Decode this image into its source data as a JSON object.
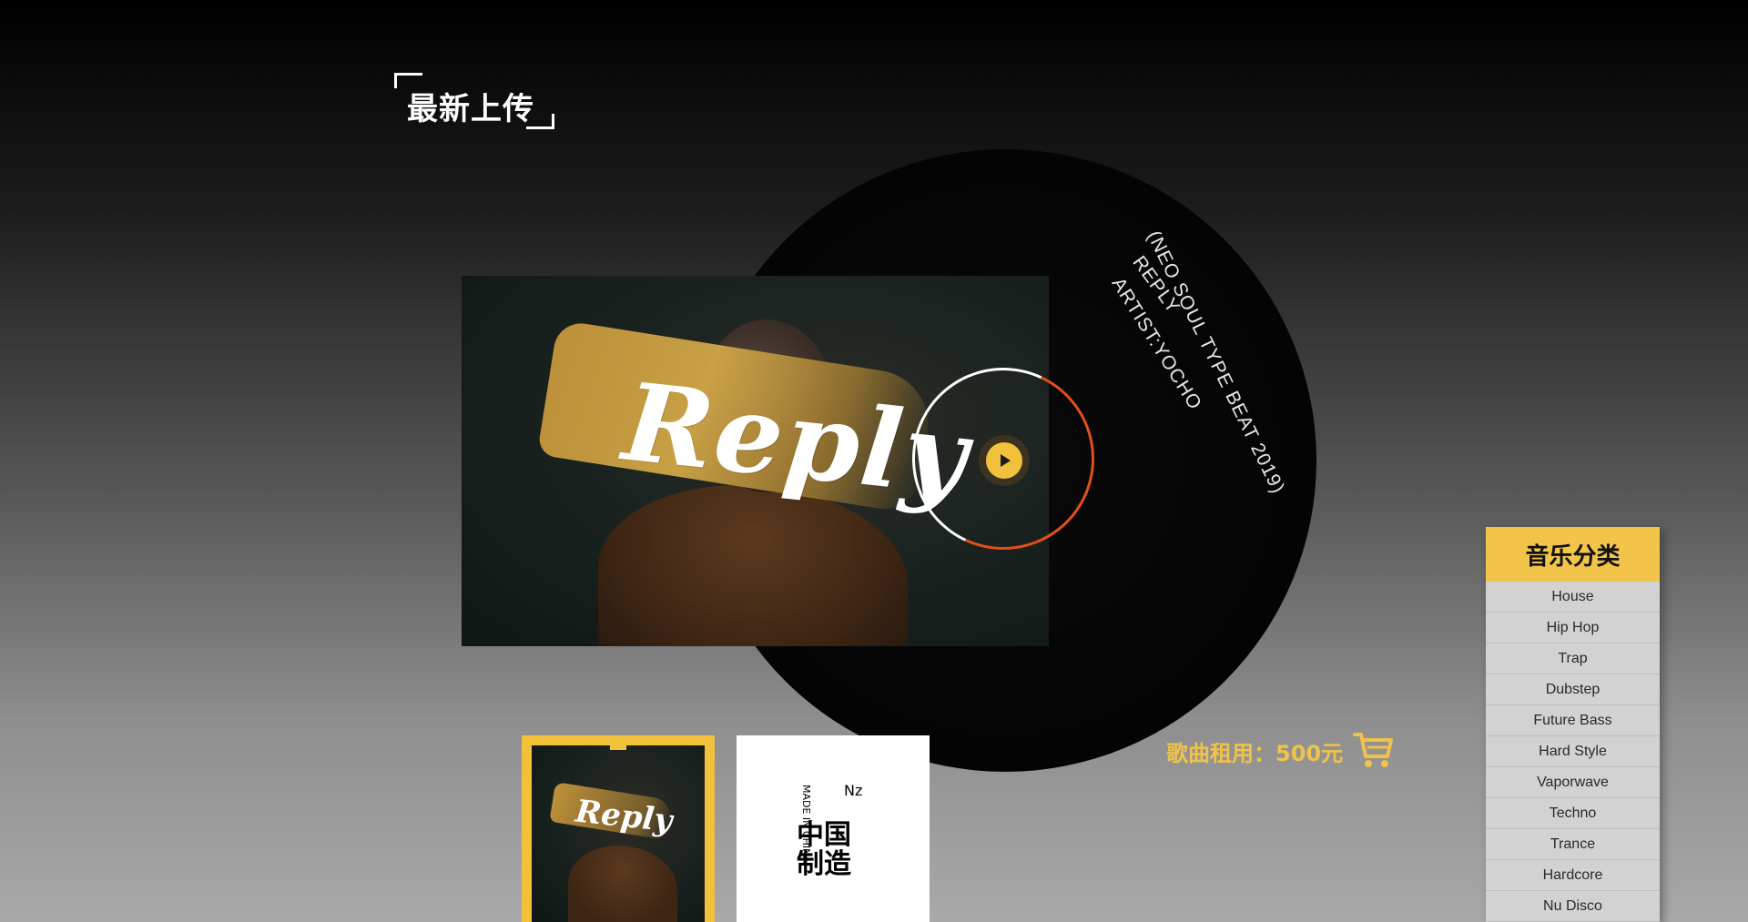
{
  "section": {
    "title": "最新上传"
  },
  "record": {
    "line1": "(NEO SOUL TYPE BEAT 2019)",
    "line2": "REPLY",
    "line3": "ARTIST:YOCHO"
  },
  "cover": {
    "title": "Reply"
  },
  "player": {
    "play_icon": "play-icon",
    "accent": "#f2c13c",
    "ring_color": "#e44e1a"
  },
  "price": {
    "label": "歌曲租用：500元",
    "cart_icon": "cart-icon"
  },
  "thumbnails": [
    {
      "title": "Reply",
      "selected": true
    },
    {
      "top_text": "Nz",
      "side_text": "MADE IN CHINA",
      "main_text": "中国制造"
    }
  ],
  "categories": {
    "title": "音乐分类",
    "items": [
      "House",
      "Hip Hop",
      "Trap",
      "Dubstep",
      "Future Bass",
      "Hard Style",
      "Vaporwave",
      "Techno",
      "Trance",
      "Hardcore",
      "Nu Disco"
    ]
  }
}
